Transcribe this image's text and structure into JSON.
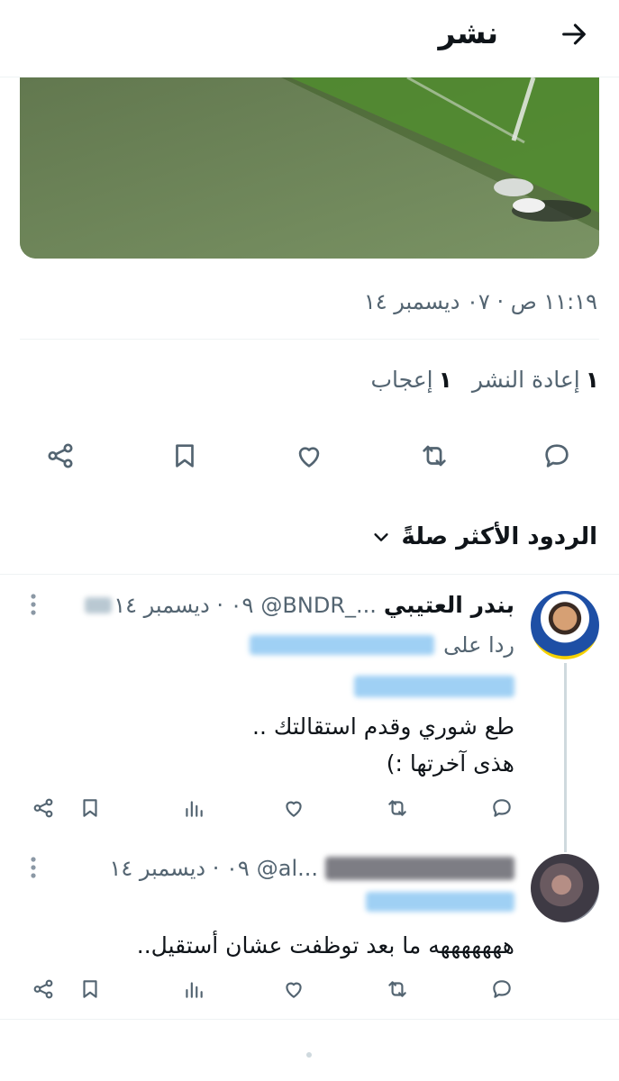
{
  "header": {
    "title": "نشر",
    "back_icon": "arrow-right-icon"
  },
  "post": {
    "timestamp": "١١:١٩ ص · ٠٧ ديسمبر ١٤",
    "retweets_count": "١",
    "retweets_label": "إعادة النشر",
    "likes_count": "١",
    "likes_label": "إعجاب",
    "actions": [
      "reply-icon",
      "retweet-icon",
      "like-icon",
      "bookmark-icon",
      "share-icon"
    ]
  },
  "replies_sort": {
    "label": "الردود الأكثر صلةً"
  },
  "replies": [
    {
      "name": "بندر العتيبي",
      "handle": "@BNDR_...",
      "date": "٠٩ · ديسمبر ١٤",
      "reply_to_label": "ردا على",
      "mention": "@...",
      "body": [
        "طع شوري وقدم استقالتك ..",
        "هذى آخرتها :)"
      ]
    },
    {
      "name": "",
      "handle": "@al...",
      "date": "٠٩ · ديسمبر ١٤",
      "mention": "",
      "body": [
        "هههههههه ما بعد توظفت عشان أستقيل.."
      ]
    }
  ],
  "colors": {
    "text": "#0f1419",
    "secondary": "#536471",
    "accent": "#1d9bf0",
    "divider": "#eff3f4"
  }
}
